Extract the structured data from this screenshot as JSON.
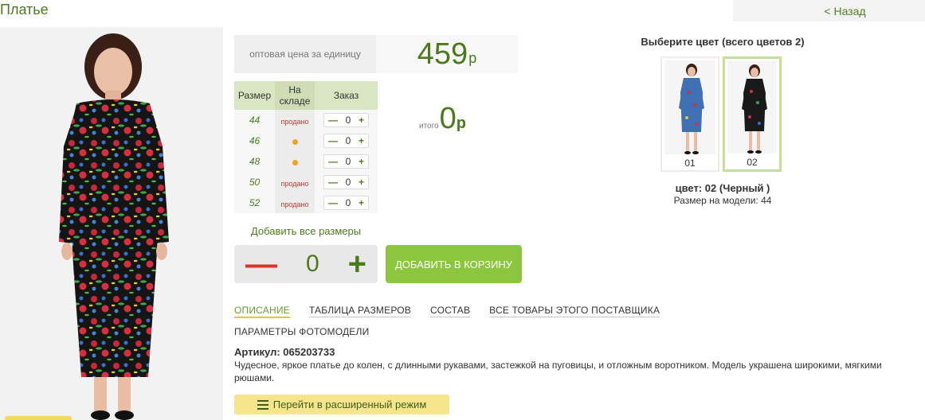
{
  "page": {
    "title": "Платье",
    "back_label": "< Назад"
  },
  "price": {
    "label": "оптовая цена за единицу",
    "value": "459",
    "currency": "р"
  },
  "sizes_table": {
    "headers": {
      "size": "Размер",
      "stock": "На складе",
      "order": "Заказ"
    },
    "rows": [
      {
        "size": "44",
        "stock": "продано",
        "stock_state": "sold",
        "qty": "0"
      },
      {
        "size": "46",
        "stock": "",
        "stock_state": "available",
        "qty": "0"
      },
      {
        "size": "48",
        "stock": "",
        "stock_state": "available",
        "qty": "0"
      },
      {
        "size": "50",
        "stock": "продано",
        "stock_state": "sold",
        "qty": "0"
      },
      {
        "size": "52",
        "stock": "продано",
        "stock_state": "sold",
        "qty": "0"
      }
    ],
    "minus_symbol": "—",
    "plus_symbol": "+"
  },
  "total": {
    "label": "итого",
    "value": "0",
    "currency": "р"
  },
  "add_all_sizes": "Добавить все размеры",
  "quantity": {
    "minus": "—",
    "value": "0",
    "plus": "+"
  },
  "add_to_cart": "ДОБАВИТЬ В КОРЗИНУ",
  "tabs": [
    {
      "label": "ОПИСАНИЕ",
      "active": true
    },
    {
      "label": "ТАБЛИЦА РАЗМЕРОВ",
      "active": false
    },
    {
      "label": "СОСТАВ",
      "active": false
    },
    {
      "label": "ВСЕ ТОВАРЫ ЭТОГО ПОСТАВЩИКА",
      "active": false
    },
    {
      "label": "ПАРАМЕТРЫ ФОТОМОДЕЛИ",
      "active": false
    }
  ],
  "article": "Артикул: 065203733",
  "description": "Чудесное, яркое платье до колен, с длинными рукавами, застежкой на пуговицы, и отложным воротником. Модель украшена широкими, мягкими рюшами.",
  "extended_mode": {
    "icon": "list-icon",
    "label": "Перейти в расширенный режим"
  },
  "colors": {
    "title": "Выберите цвет (всего цветов 2)",
    "swatches": [
      {
        "label": "01",
        "selected": false,
        "dress_color": "#3f6fb5"
      },
      {
        "label": "02",
        "selected": true,
        "dress_color": "#1a1a1a"
      }
    ],
    "selected_name": "цвет: 02 (Черный )",
    "model_size": "Размер на модели: 44"
  },
  "colors_palette": {
    "accent": "#4b7a1c",
    "button": "#8cc63f",
    "sold": "#c0392b",
    "dot": "#f0a21b",
    "highlight": "#f7e58d"
  }
}
